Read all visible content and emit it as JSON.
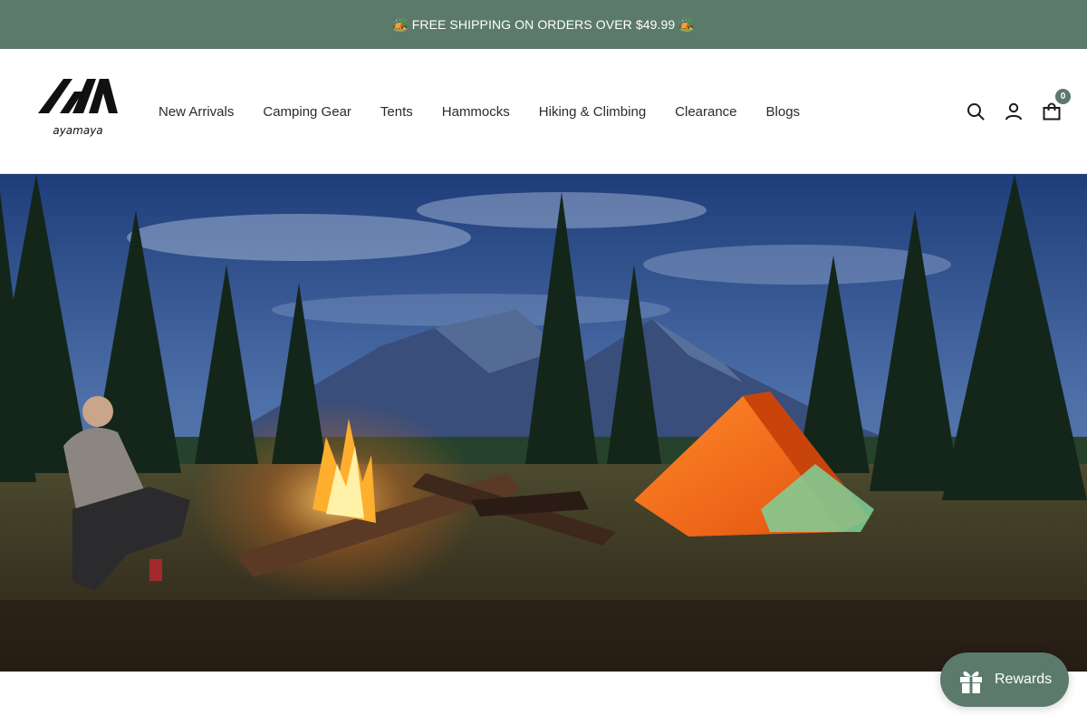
{
  "announcement": {
    "text": "🏕️ FREE SHIPPING ON ORDERS OVER $49.99 🏕️"
  },
  "header": {
    "logo_text": "ayamaya",
    "nav": [
      {
        "label": "New Arrivals"
      },
      {
        "label": "Camping Gear"
      },
      {
        "label": "Tents"
      },
      {
        "label": "Hammocks"
      },
      {
        "label": "Hiking & Climbing"
      },
      {
        "label": "Clearance"
      },
      {
        "label": "Blogs"
      }
    ],
    "icons": [
      "search-icon",
      "account-icon",
      "cart-icon"
    ],
    "cart_count": "0"
  },
  "hero": {
    "image": "night campsite with campfire, seated man and orange tent below mountains"
  },
  "rewards": {
    "label": "Rewards",
    "icon": "gift-icon"
  },
  "colors": {
    "accent": "#5b7a6b",
    "text": "#2b2b2b",
    "tent": "#f26a1b"
  }
}
